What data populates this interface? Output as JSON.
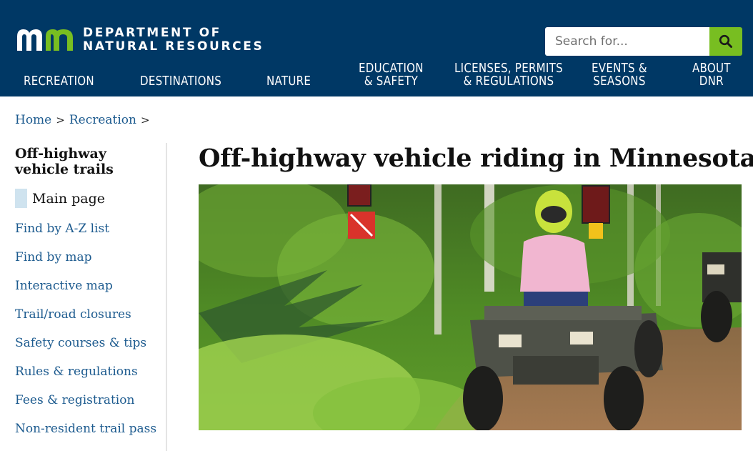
{
  "header": {
    "logo_alt": "mn",
    "org_line1": "DEPARTMENT OF",
    "org_line2": "NATURAL RESOURCES",
    "search_placeholder": "Search for...",
    "search_icon": "search-icon",
    "colors": {
      "header_bg": "#003865",
      "accent": "#78be21",
      "link": "#1d5b8f"
    }
  },
  "nav": [
    {
      "label": "RECREATION"
    },
    {
      "label": "DESTINATIONS"
    },
    {
      "label": "NATURE"
    },
    {
      "label": "EDUCATION\n& SAFETY"
    },
    {
      "label": "LICENSES, PERMITS\n& REGULATIONS"
    },
    {
      "label": "EVENTS &\nSEASONS"
    },
    {
      "label": "ABOUT\nDNR"
    }
  ],
  "breadcrumb": {
    "home": "Home",
    "recreation": "Recreation",
    "separator": ">"
  },
  "sidebar": {
    "title": "Off-highway vehicle trails",
    "current": "Main page",
    "links": [
      "Find by A-Z list",
      "Find by map",
      "Interactive map",
      "Trail/road closures",
      "Safety courses & tips",
      "Rules & regulations",
      "Fees & registration",
      "Non-resident trail pass"
    ]
  },
  "main": {
    "title": "Off-highway vehicle riding in Minnesota",
    "hero_alt": "ATV rider on a forest trail"
  }
}
